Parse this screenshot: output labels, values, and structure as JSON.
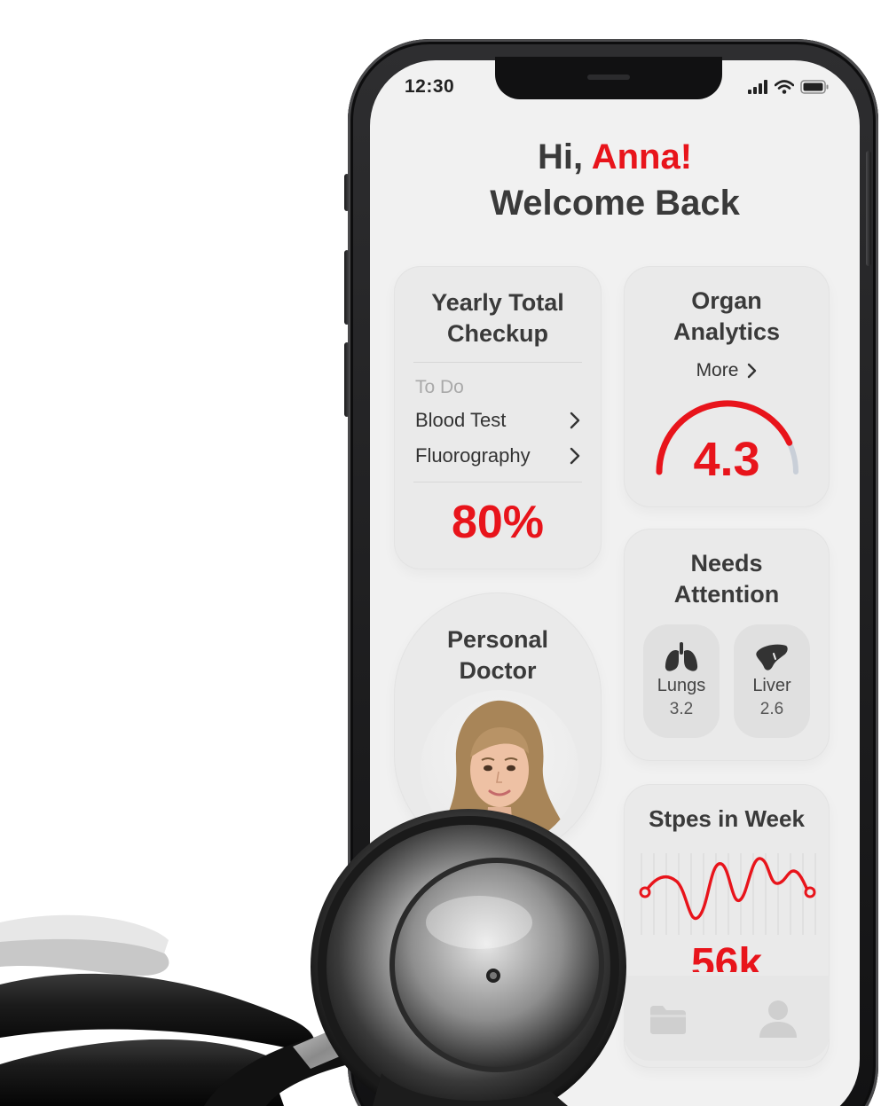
{
  "status": {
    "time": "12:30",
    "icons": [
      "signal-icon",
      "wifi-icon",
      "battery-icon"
    ]
  },
  "greeting": {
    "hi": "Hi, ",
    "name": "Anna!",
    "welcome": "Welcome Back"
  },
  "checkup": {
    "title": "Yearly Total Checkup",
    "todo_label": "To Do",
    "items": [
      {
        "label": "Blood Test"
      },
      {
        "label": "Fluorography"
      }
    ],
    "progress_label": "80%",
    "progress": 0.8
  },
  "organ_analytics": {
    "title": "Organ Analytics",
    "more_label": "More",
    "score": "4.3",
    "score_value": 4.3
  },
  "needs_attention": {
    "title": "Needs Attention",
    "organs": [
      {
        "name": "Lungs",
        "value": "3.2",
        "icon": "lungs-icon"
      },
      {
        "name": "Liver",
        "value": "2.6",
        "icon": "liver-icon"
      }
    ]
  },
  "personal_doctor": {
    "title": "Personal Doctor"
  },
  "steps": {
    "title": "Stpes in Week",
    "total": "56k"
  },
  "tabbar": {
    "icons": [
      "folder-icon",
      "profile-icon"
    ]
  },
  "colors": {
    "accent": "#e8141b",
    "background": "#f1f1f1",
    "card": "#eaeaea",
    "text": "#333333",
    "muted": "#a9a9a9",
    "gauge_track": "#c9cfd8"
  }
}
